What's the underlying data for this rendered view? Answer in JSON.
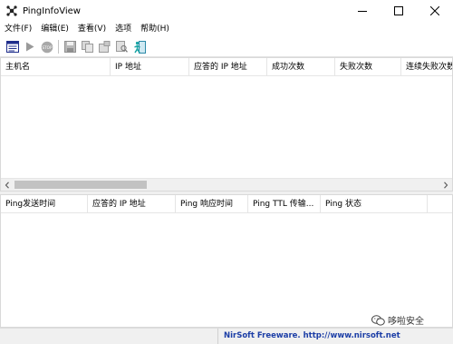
{
  "window": {
    "title": "PingInfoView"
  },
  "menu": {
    "items": [
      "文件(F)",
      "编辑(E)",
      "查看(V)",
      "选项",
      "帮助(H)"
    ]
  },
  "top_table": {
    "columns": [
      "主机名",
      "IP 地址",
      "应答的 IP 地址",
      "成功次数",
      "失败次数",
      "连续失败次数"
    ]
  },
  "bottom_table": {
    "columns": [
      "Ping发送时间",
      "应答的 IP 地址",
      "Ping 响应时间",
      "Ping TTL 传输...",
      "Ping 状态"
    ]
  },
  "status": {
    "credit": "NirSoft Freeware.  http://www.nirsoft.net"
  },
  "watermark": {
    "text": "哆啦安全"
  },
  "colors": {
    "credit": "#1c3ea6",
    "accent_teal": "#17a5a5"
  }
}
